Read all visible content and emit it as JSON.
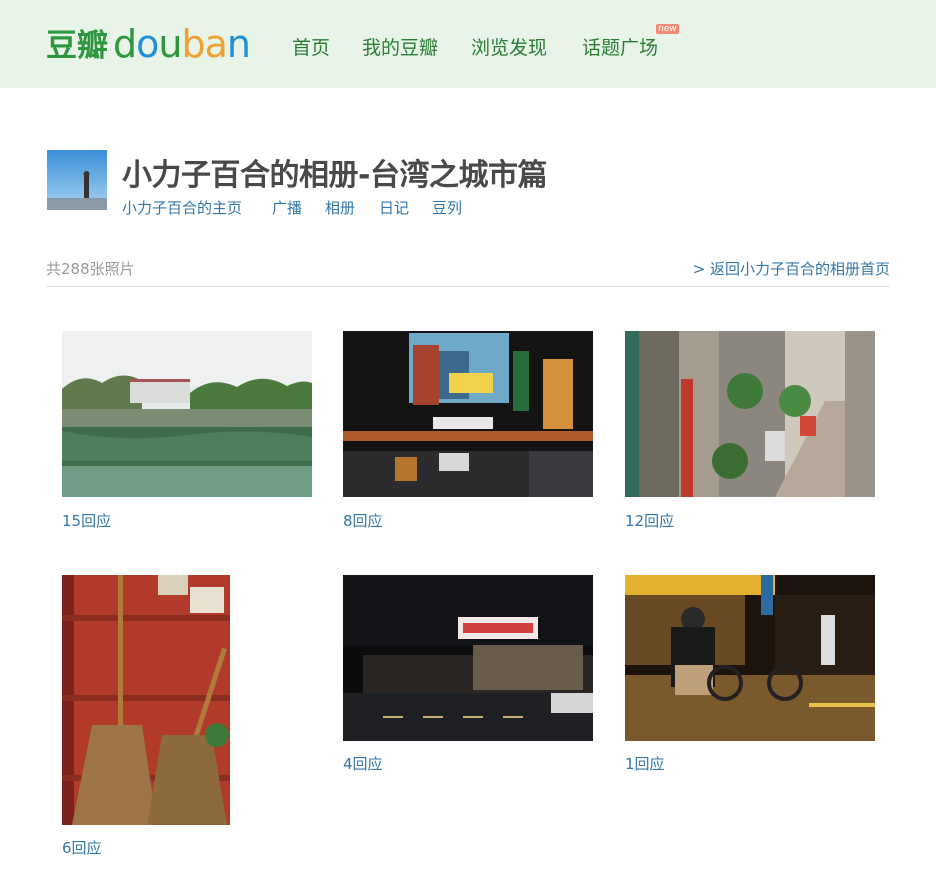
{
  "site": {
    "logo_cn": "豆瓣",
    "logo_en": [
      "d",
      "o",
      "u",
      "b",
      "a",
      "n"
    ],
    "nav": [
      "首页",
      "我的豆瓣",
      "浏览发现",
      "话题广场"
    ],
    "new_badge": "new"
  },
  "album": {
    "title": "小力子百合的相册-台湾之城市篇",
    "links": [
      "小力子百合的主页",
      "广播",
      "相册",
      "日记",
      "豆列"
    ],
    "photo_count": "共288张照片",
    "back_link": "> 返回小力子百合的相册首页"
  },
  "photos": [
    {
      "replies": "15回应"
    },
    {
      "replies": "8回应"
    },
    {
      "replies": "12回应"
    },
    {
      "replies": "6回应"
    },
    {
      "replies": "4回应"
    },
    {
      "replies": "1回应"
    }
  ],
  "colors": {
    "brand_green": "#2e963d",
    "link_blue": "#3377aa",
    "header_bg": "#e9f4e9"
  }
}
